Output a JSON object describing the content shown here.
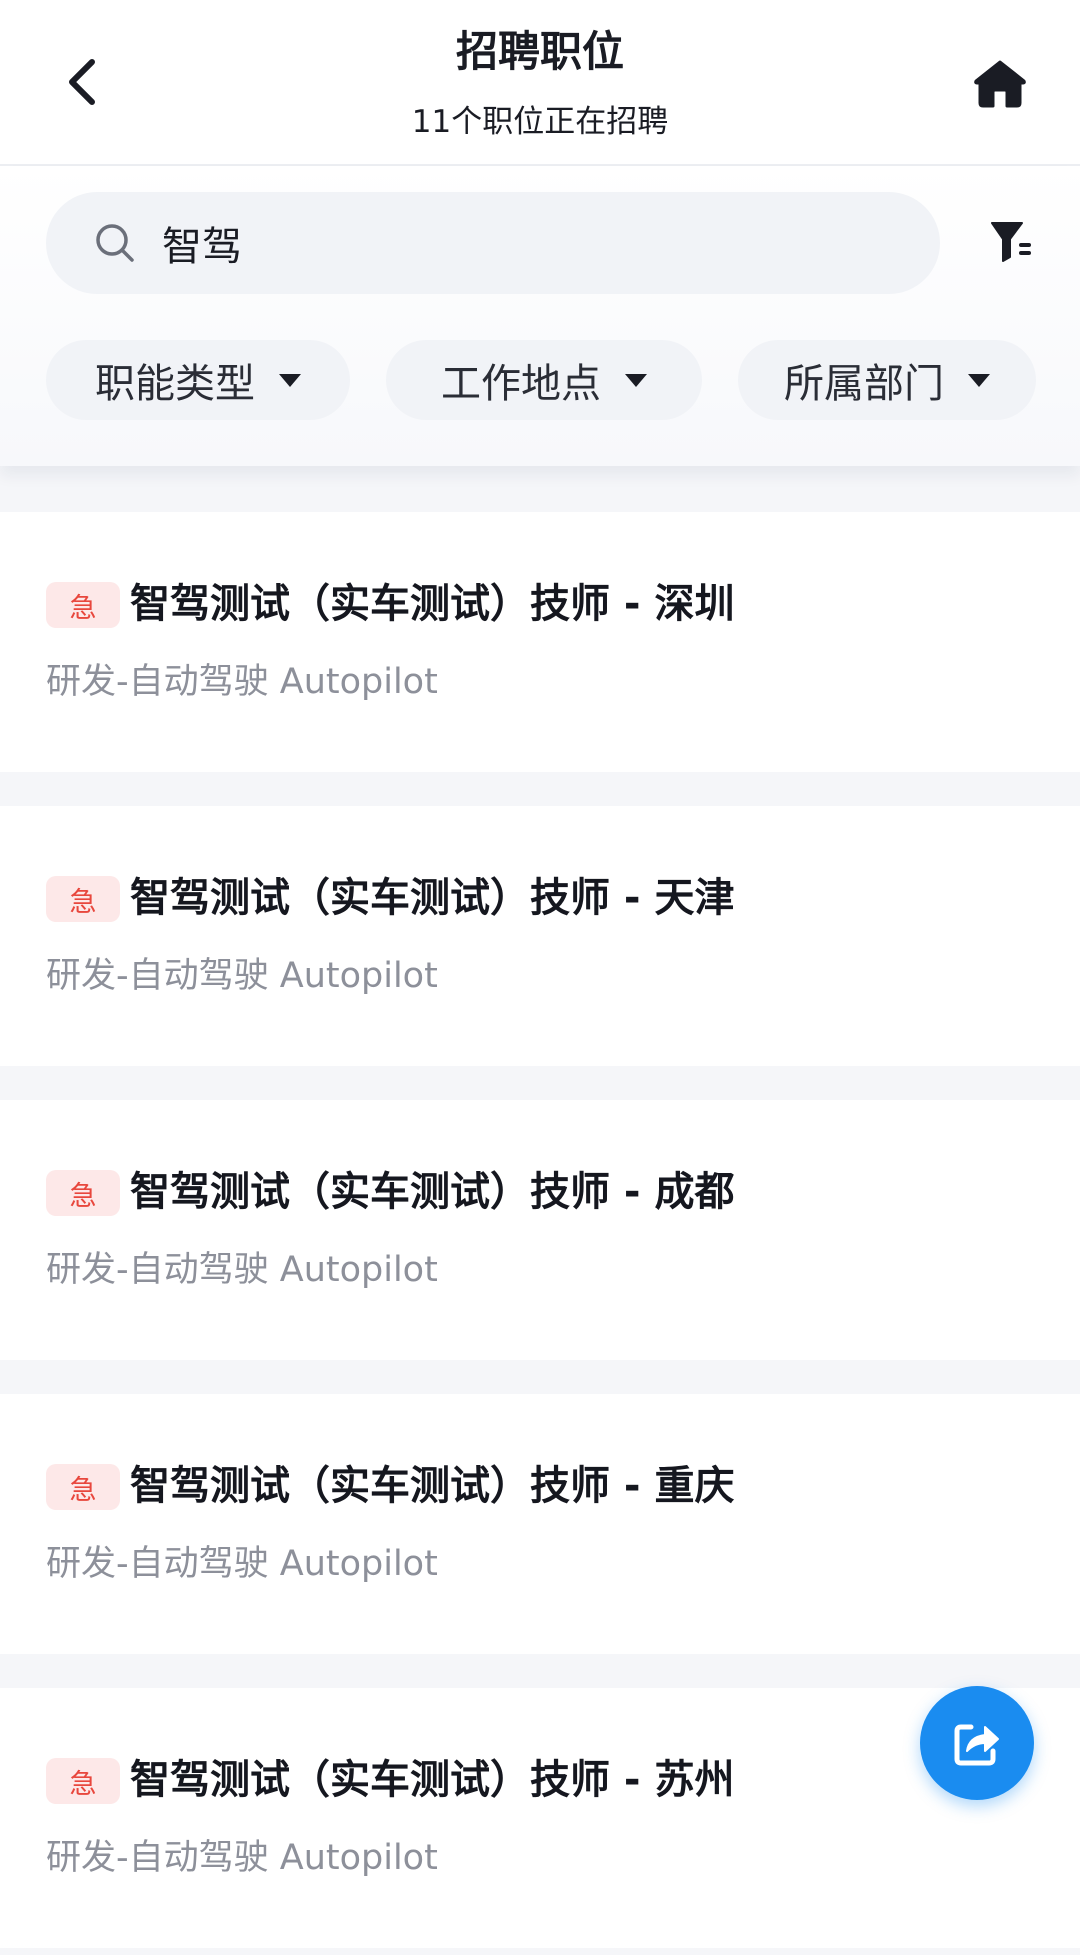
{
  "header": {
    "title": "招聘职位",
    "subtitle": "11个职位正在招聘"
  },
  "search": {
    "value": "智驾",
    "placeholder": ""
  },
  "filters": [
    {
      "label": "职能类型"
    },
    {
      "label": "工作地点"
    },
    {
      "label": "所属部门"
    }
  ],
  "jobs": [
    {
      "badge": "急",
      "title": "智驾测试（实车测试）技师 - 深圳",
      "dept": "研发-自动驾驶 Autopilot"
    },
    {
      "badge": "急",
      "title": "智驾测试（实车测试）技师 - 天津",
      "dept": "研发-自动驾驶 Autopilot"
    },
    {
      "badge": "急",
      "title": "智驾测试（实车测试）技师 - 成都",
      "dept": "研发-自动驾驶 Autopilot"
    },
    {
      "badge": "急",
      "title": "智驾测试（实车测试）技师 - 重庆",
      "dept": "研发-自动驾驶 Autopilot"
    },
    {
      "badge": "急",
      "title": "智驾测试（实车测试）技师 - 苏州",
      "dept": "研发-自动驾驶 Autopilot"
    }
  ],
  "colors": {
    "accent": "#1a8cf0",
    "urgent": "#e8473d",
    "urgent_bg": "#fde8e8"
  },
  "icons": {
    "back": "chevron-left-icon",
    "home": "home-icon",
    "search": "search-icon",
    "filter": "filter-icon",
    "share": "share-icon"
  }
}
